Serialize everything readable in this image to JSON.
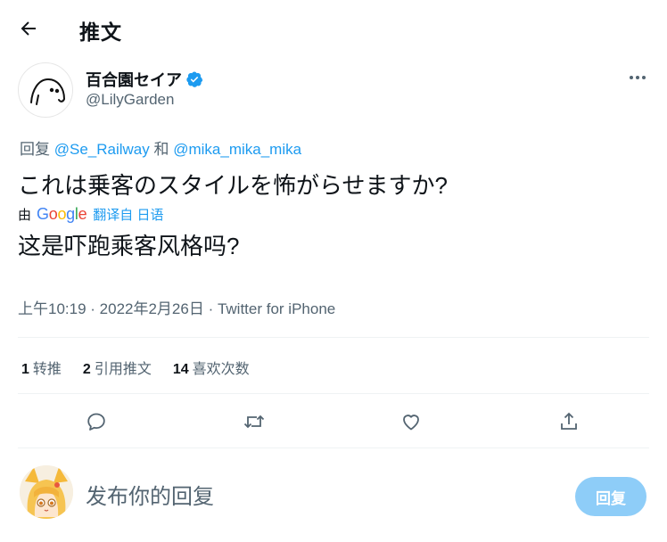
{
  "header": {
    "title": "推文",
    "back_icon": "arrow-left-icon"
  },
  "author": {
    "display_name": "百合園セイア",
    "handle": "@LilyGarden",
    "verified_color": "#1d9bf0"
  },
  "reply_context": {
    "prefix": "回复",
    "mention1": "@Se_Railway",
    "conjunction": "和",
    "mention2": "@mika_mika_mika"
  },
  "tweet": {
    "text": "これは乗客のスタイルを怖がらせますか?",
    "translation_by": "由",
    "google": [
      "G",
      "o",
      "o",
      "g",
      "l",
      "e"
    ],
    "google_colors": [
      "#4285f4",
      "#ea4335",
      "#fbbc05",
      "#4285f4",
      "#34a853",
      "#ea4335"
    ],
    "translated_from": "翻译自 日语",
    "translated_text": "这是吓跑乘客风格吗?"
  },
  "meta": {
    "time": "上午10:19",
    "date": "2022年2月26日",
    "source": "Twitter for iPhone"
  },
  "stats": [
    {
      "count": "1",
      "label": "转推"
    },
    {
      "count": "2",
      "label": "引用推文"
    },
    {
      "count": "14",
      "label": "喜欢次数"
    }
  ],
  "actions": [
    "reply-icon",
    "retweet-icon",
    "like-icon",
    "share-icon"
  ],
  "reply_box": {
    "placeholder": "发布你的回复",
    "button_label": "回复"
  },
  "colors": {
    "accent": "#1d9bf0",
    "secondary_text": "#536471",
    "reply_button_disabled": "#8ecdf8"
  }
}
